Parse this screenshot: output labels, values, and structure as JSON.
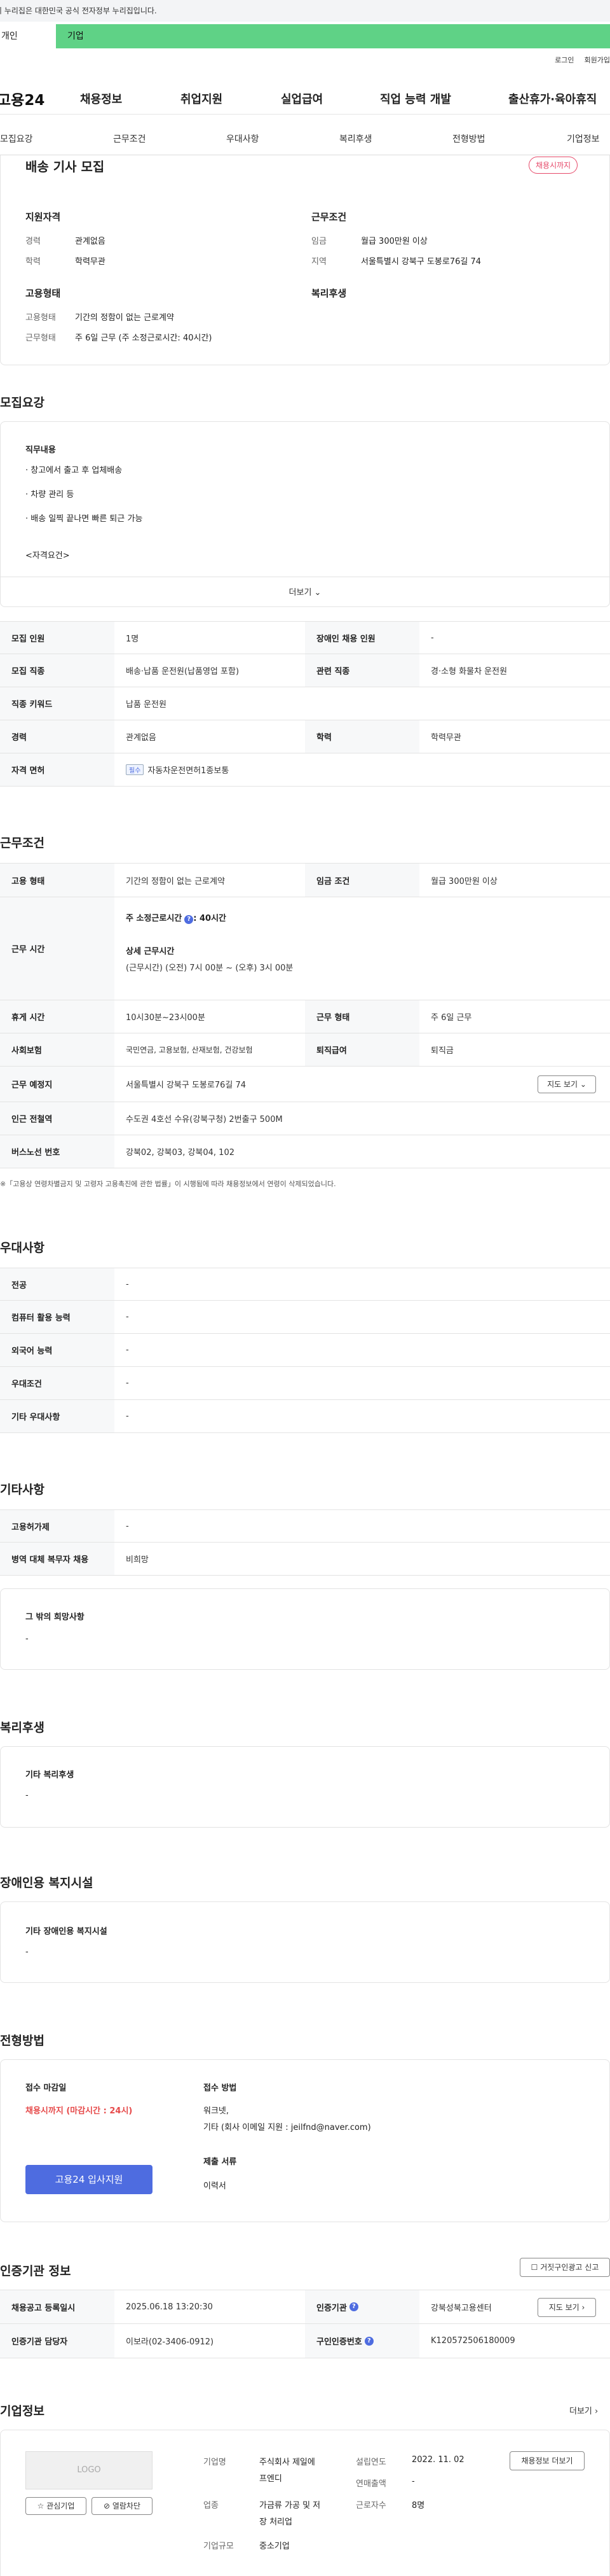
{
  "gov_banner": {
    "text": "이 누리집은 대한민국 공식 전자정부 누리집입니다."
  },
  "tabs": {
    "left": "개인",
    "right": "기업"
  },
  "util": {
    "login": "로그인",
    "signup": "회원가입"
  },
  "gnb": {
    "logo": "고용24",
    "items": [
      "채용정보",
      "취업지원",
      "실업급여",
      "직업 능력 개발",
      "출산휴가·육아휴직"
    ]
  },
  "lnb": {
    "items": [
      "모집요강",
      "근무조건",
      "우대사항",
      "복리후생",
      "전형방법",
      "기업정보"
    ]
  },
  "summary": {
    "title": "배송 기사 모집",
    "badge": "채용시까지",
    "qual_head": "지원자격",
    "cond_head": "근무조건",
    "career_label": "경력",
    "career_value": "관계없음",
    "edu_label": "학력",
    "edu_value": "학력무관",
    "wage_label": "임금",
    "wage_value": "월급 300만원 이상",
    "region_label": "지역",
    "region_value": "서울특별시 강북구 도봉로76길 74",
    "emp_head": "고용형태",
    "welfare_head": "복리후생",
    "emp_type_label": "고용형태",
    "emp_type_value": "기간의 정함이 없는 근로계약",
    "work_type_label": "근무형태",
    "work_type_value": "주 6일 근무 (주 소정근로시간: 40시간)"
  },
  "recruit": {
    "heading": "모집요강",
    "duty_head": "직무내용",
    "duties": [
      "· 창고에서 출고 후 업체배송",
      "· 차량 관리 등",
      "· 배송 일찍 끝나면 빠른 퇴근 가능"
    ],
    "qual_more": "<자격요건>",
    "more_btn": "더보기 ⌄",
    "rows": {
      "r1_l": "모집 인원",
      "r1_v": "1명",
      "r1_l2": "장애인 채용 인원",
      "r1_v2": "-",
      "r2_l": "모집 직종",
      "r2_v": "배송·납품 운전원(납품영업 포함)",
      "r2_l2": "관련 직종",
      "r2_v2": "경·소형 화물차 운전원",
      "r3_l": "직종 키워드",
      "r3_v": "납품 운전원",
      "r4_l": "경력",
      "r4_v": "관계없음",
      "r4_l2": "학력",
      "r4_v2": "학력무관",
      "r5_l": "자격 면허",
      "r5_tag": "필수",
      "r5_v": "자동차운전면허1종보통"
    }
  },
  "conditions": {
    "heading": "근무조건",
    "emp_l": "고용 형태",
    "emp_v": "기간의 정함이 없는 근로계약",
    "wage_l": "임금 조건",
    "wage_v": "월급 300만원 이상",
    "time_l": "근무 시간",
    "time_main": "주 소정근로시간",
    "time_main_v": ": 40시간",
    "time_detail_h": "상세 근무시간",
    "time_detail": "(근무시간) (오전) 7시 00분 ~ (오후) 3시 00분",
    "rest_l": "휴게 시간",
    "rest_v": "10시30분~23시00분",
    "form_l": "근무 형태",
    "form_v": "주 6일 근무",
    "ins_l": "사회보험",
    "ins_v": "국민연금, 고용보험, 산재보험, 건강보험",
    "sev_l": "퇴직급여",
    "sev_v": "퇴직금",
    "loc_l": "근무 예정지",
    "loc_v": "서울특별시 강북구 도봉로76길 74",
    "map_btn": "지도 보기 ⌄",
    "sub_l": "인근 전철역",
    "sub_v": "수도권 4호선 수유(강북구청) 2번출구 500M",
    "bus_l": "버스노선 번호",
    "bus_v": "강북02, 강북03, 강북04, 102",
    "note": "※「고용상 연령차별금지 및 고령자 고용촉진에 관한 법률」이 시행됨에 따라 채용정보에서 연령이 삭제되었습니다."
  },
  "prefer": {
    "heading": "우대사항",
    "rows": [
      {
        "l": "전공",
        "v": "-"
      },
      {
        "l": "컴퓨터 활용 능력",
        "v": "-"
      },
      {
        "l": "외국어 능력",
        "v": "-"
      },
      {
        "l": "우대조건",
        "v": "-"
      },
      {
        "l": "기타 우대사항",
        "v": "-"
      }
    ]
  },
  "etc": {
    "heading": "기타사항",
    "rows": [
      {
        "l": "고용허가제",
        "v": "-"
      },
      {
        "l": "병역 대체 복무자 채용",
        "v": "비희망"
      }
    ],
    "other_h": "그 밖의 희망사항",
    "other_v": "-"
  },
  "welfare": {
    "heading": "복리후생",
    "box_h": "기타 복리후생",
    "box_v": "-"
  },
  "disabled": {
    "heading": "장애인용 복지시설",
    "box_h": "기타 장애인용 복지시설",
    "box_v": "-"
  },
  "process": {
    "heading": "전형방법",
    "deadline_h": "접수 마감일",
    "deadline_v": "채용시까지 (마감시간 : 24시)",
    "apply_btn": "고용24 입사지원",
    "method_h": "접수 방법",
    "method_1": "워크넷,",
    "method_2": "기타 (회사 이메일 지원 : jeilfnd@naver.com)",
    "docs_h": "제출 서류",
    "docs_v": "이력서"
  },
  "agency": {
    "heading": "인증기관 정보",
    "report_btn": "거짓구인광고 신고",
    "reg_l": "채용공고 등록일시",
    "reg_v": "2025.06.18 13:20:30",
    "org_l": "인증기관",
    "org_v": "강북성북고용센터",
    "map_btn": "지도 보기 ›",
    "mgr_l": "인증기관 담당자",
    "mgr_v": "이보라(02-3406-0912)",
    "no_l": "구인인증번호",
    "no_v": "K120572506180009"
  },
  "company": {
    "heading": "기업정보",
    "more": "더보기 ›",
    "logo": "LOGO",
    "fav_btn": "☆ 관심기업",
    "block_btn": "⊘ 열람차단",
    "name_l": "기업명",
    "name_v1": "주식회사 제일에",
    "name_v2": "프엔디",
    "ind_l": "업종",
    "ind_v1": "가금류 가공 및 저",
    "ind_v2": "장 처리업",
    "size_l": "기업규모",
    "size_v": "중소기업",
    "found_l": "설립연도",
    "found_v": "2022. 11. 02",
    "sales_l": "연매출액",
    "sales_v": "-",
    "staff_l": "근로자수",
    "staff_v": "8명",
    "hire_btn": "채용정보 더보기"
  }
}
